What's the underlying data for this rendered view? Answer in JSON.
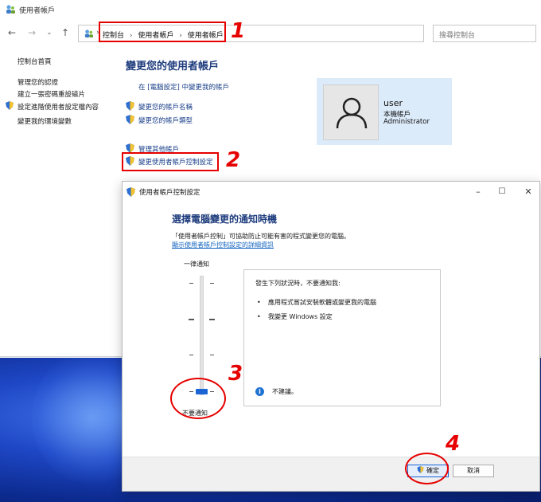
{
  "control_panel": {
    "window_title": "使用者帳戶",
    "breadcrumb": [
      "控制台",
      "使用者帳戶",
      "使用者帳戶"
    ],
    "search_placeholder": "搜尋控制台",
    "left_nav": [
      "控制台首頁",
      "管理您的認證",
      "建立一張密碼重設磁片",
      "設定進階使用者設定檔內容",
      "變更我的環境變數"
    ],
    "main_title": "變更您的使用者帳戶",
    "links": [
      "在 [電腦設定] 中變更我的帳戶",
      "變更您的帳戶名稱",
      "變更您的帳戶類型",
      "管理其他帳戶",
      "變更使用者帳戶控制設定"
    ],
    "user": {
      "name": "user",
      "account_type": "本機帳戶",
      "role": "Administrator"
    }
  },
  "dialog": {
    "title": "使用者帳戶控制設定",
    "heading": "選擇電腦變更的通知時機",
    "description": "「使用者帳戶控制」可協助防止可能有害的程式變更您的電腦。",
    "learn_more_link": "顯示使用者帳戶控制設定的詳細資訊",
    "slider": {
      "top_label": "一律通知",
      "bottom_label": "不要通知",
      "level": 0,
      "levels": 4
    },
    "info": {
      "heading": "發生下列狀況時，不要通知我:",
      "bullets": [
        "應用程式嘗試安裝軟體或變更我的電腦",
        "我變更 Windows 設定"
      ],
      "recommendation": "不建議。"
    },
    "buttons": {
      "ok": "確定",
      "cancel": "取消"
    }
  },
  "annotations": [
    "1",
    "2",
    "3",
    "4"
  ],
  "colors": {
    "annotation": "#e60000",
    "title_blue": "#1e3c7d",
    "slider_thumb": "#1a64d6",
    "user_card": "#dcebfa"
  }
}
